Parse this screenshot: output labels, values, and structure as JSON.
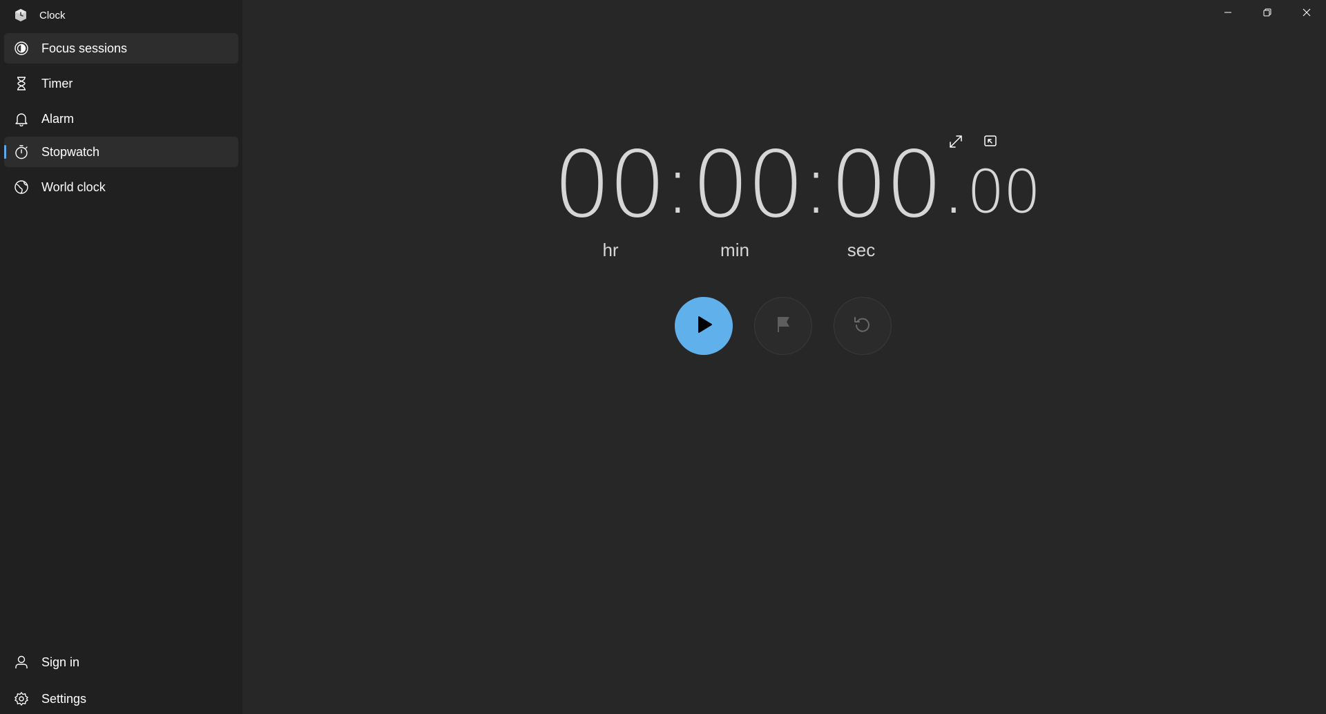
{
  "app": {
    "title": "Clock"
  },
  "nav": {
    "items": [
      {
        "label": "Focus sessions",
        "icon": "focus-icon"
      },
      {
        "label": "Timer",
        "icon": "hourglass-icon"
      },
      {
        "label": "Alarm",
        "icon": "bell-icon"
      },
      {
        "label": "Stopwatch",
        "icon": "stopwatch-icon",
        "selected": true
      },
      {
        "label": "World clock",
        "icon": "globe-icon"
      }
    ],
    "footer": [
      {
        "label": "Sign in",
        "icon": "person-icon"
      },
      {
        "label": "Settings",
        "icon": "gear-icon"
      }
    ]
  },
  "stopwatch": {
    "hours": "00",
    "minutes": "00",
    "seconds": "00",
    "hundredths": "00",
    "sep": ":",
    "dot": ".",
    "units": {
      "hr": "hr",
      "min": "min",
      "sec": "sec"
    }
  },
  "colors": {
    "accent": "#60b0ec",
    "background": "#272727",
    "sidebar": "#202020"
  }
}
